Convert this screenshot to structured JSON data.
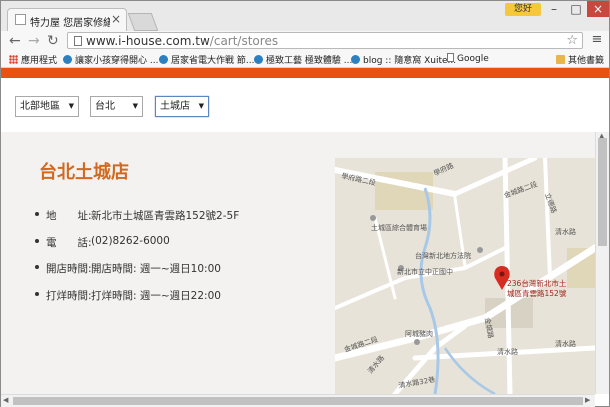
{
  "browser": {
    "tab_title": "特力屋 您居家修繕的好幫手",
    "tab_close": "×",
    "profile_label": "您好",
    "url_host": "www.i-house.com.tw",
    "url_path": "/cart/stores",
    "bookmarks": [
      {
        "label": "應用程式",
        "icon": "apps-icon"
      },
      {
        "label": "讓家小孩穿得開心 ...",
        "icon": "ball-icon"
      },
      {
        "label": "居家省電大作戰 節...",
        "icon": "ball-icon"
      },
      {
        "label": "極致工藝 極致體驗 ...",
        "icon": "ball-icon"
      },
      {
        "label": "blog :: 隨意窩 Xuite...",
        "icon": "ball-icon"
      },
      {
        "label": "Google",
        "icon": "doc-icon"
      }
    ],
    "other_bookmarks": "其他書籤"
  },
  "filters": {
    "region": "北部地區",
    "city": "台北",
    "store": "土城店"
  },
  "store": {
    "title": "台北土城店",
    "details": [
      {
        "label": "地　　址:",
        "value": "新北市土城區青雲路152號2-5F"
      },
      {
        "label": "電　　話:",
        "value": "(02)8262-6000"
      },
      {
        "label": "開店時間:",
        "value": "開店時間: 週一~週日10:00"
      },
      {
        "label": "打烊時間:",
        "value": "打烊時間: 週一~週日22:00"
      }
    ]
  },
  "map": {
    "labels": {
      "road_top_left": "學府路二段",
      "road_top_mid": "學府路",
      "road_right1": "金城路二段",
      "road_right2": "立德路",
      "stadium": "土城區綜合體育場",
      "court": "台灣新北地方法院",
      "school": "新北市立中正國中",
      "qingshui": "清水路",
      "market": "阿城豬肉",
      "road_bottom_mid": "金城路",
      "road_diag": "金城路二段",
      "road_q2": "清水路",
      "road_bottom": "清水路32巷",
      "road_bottom_right": "清水路",
      "road_right3": "清水路",
      "marker_line1": "236台灣新北市土",
      "marker_line2": "城區青雲路152號"
    },
    "colors": {
      "land": "#e8e3d8",
      "road": "#ffffff",
      "water": "#a8c8e8",
      "park": "#cfdcb0",
      "marker": "#d62d20"
    }
  }
}
